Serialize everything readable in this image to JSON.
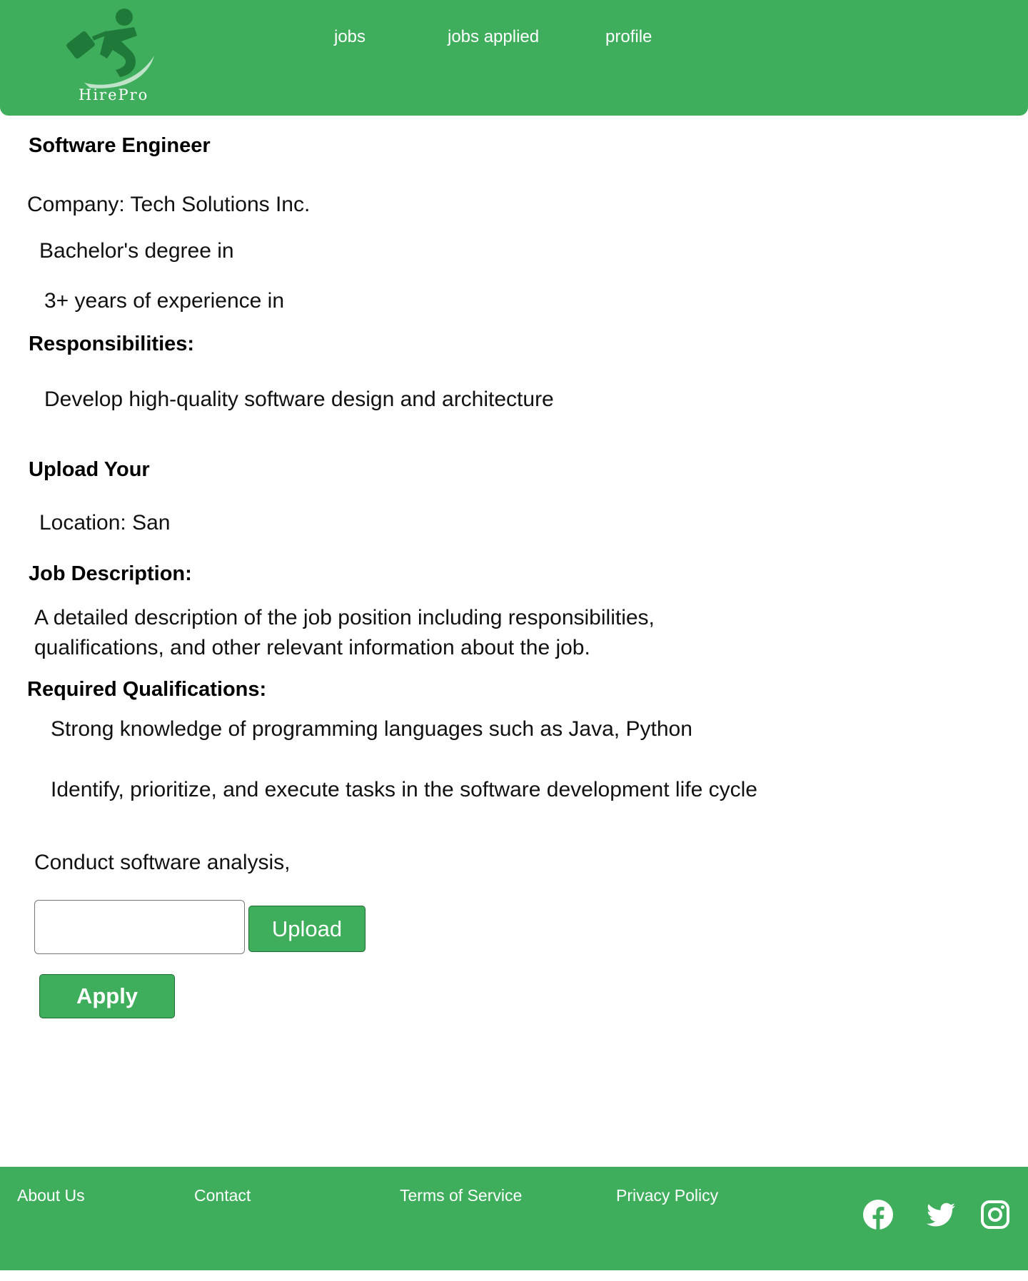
{
  "header": {
    "logo_text": "HirePro",
    "nav": [
      {
        "label": "jobs"
      },
      {
        "label": "jobs applied"
      },
      {
        "label": "profile"
      }
    ]
  },
  "job": {
    "title": "Software Engineer",
    "company": "Company: Tech Solutions Inc.",
    "degree": "Bachelor's degree in",
    "experience": "3+ years of experience in",
    "responsibilities_heading": "Responsibilities:",
    "responsibility_1": "Develop high-quality software design and architecture",
    "upload_heading": "Upload Your",
    "location": "Location: San",
    "description_heading": "Job Description:",
    "description": "A detailed description of the job position including responsibilities, qualifications, and other relevant information about the job.",
    "qualifications_heading": "Required Qualifications:",
    "qualification_1": "Strong knowledge of programming languages such as Java, Python",
    "qualification_2": "Identify, prioritize, and execute tasks in the software development life cycle",
    "analysis": "Conduct software analysis,"
  },
  "form": {
    "upload_label": "Upload",
    "apply_label": "Apply"
  },
  "footer": {
    "links": [
      {
        "label": "About Us"
      },
      {
        "label": "Contact"
      },
      {
        "label": "Terms of Service"
      },
      {
        "label": "Privacy Policy"
      }
    ],
    "social_icons": [
      "facebook-icon",
      "twitter-icon",
      "instagram-icon"
    ]
  },
  "colors": {
    "brand_green": "#3fae5c",
    "text": "#111111",
    "background": "#ffffff"
  }
}
